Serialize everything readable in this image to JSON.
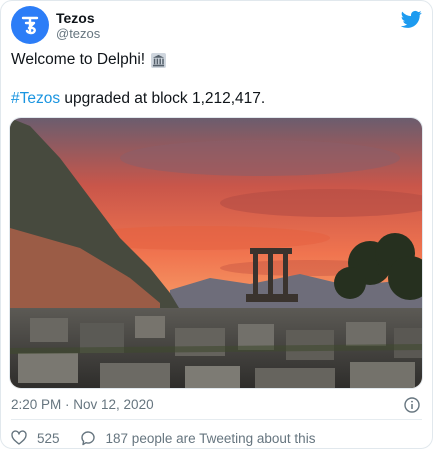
{
  "account": {
    "display_name": "Tezos",
    "handle": "@tezos"
  },
  "tweet": {
    "line1": "Welcome to Delphi!",
    "hashtag": "#Tezos",
    "line2_rest": " upgraded at block 1,212,417.",
    "timestamp": "2:20 PM · Nov 12, 2020"
  },
  "actions": {
    "like_count": "525",
    "conversation_text": "187 people are Tweeting about this"
  },
  "icons": {
    "avatar": "tezos-logo-icon",
    "brand": "twitter-bird-icon",
    "emoji": "classical-building-icon",
    "info": "info-icon",
    "like": "heart-icon",
    "reply": "speech-bubble-icon"
  },
  "colors": {
    "accent": "#1b95e0",
    "avatar_bg": "#2c7df7",
    "muted": "#66757f"
  }
}
